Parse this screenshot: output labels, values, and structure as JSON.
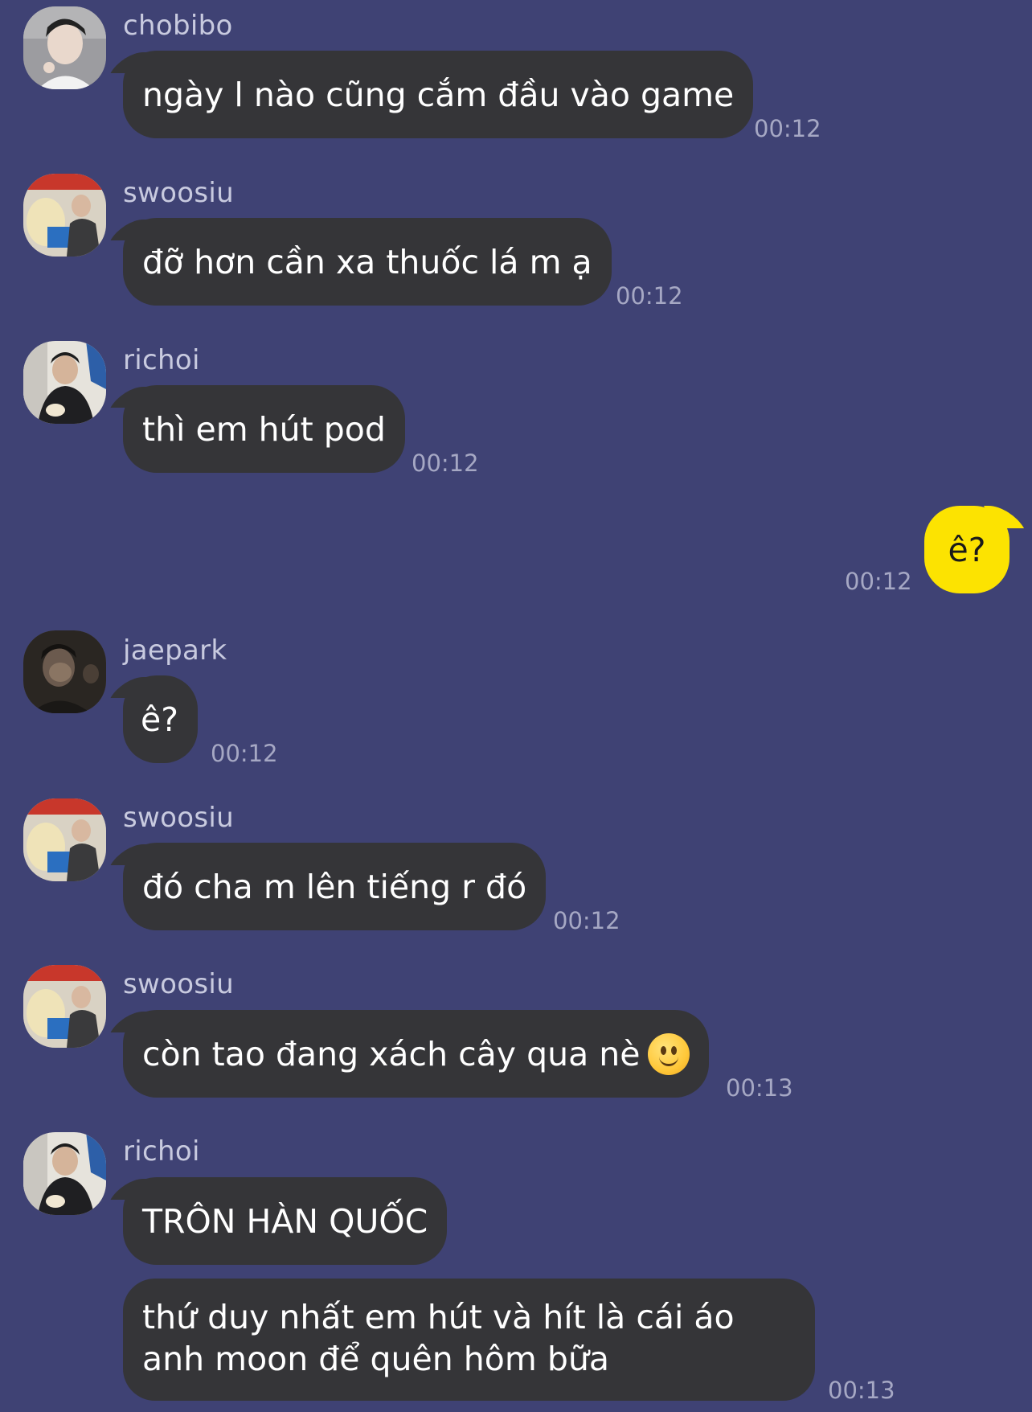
{
  "colors": {
    "background": "#3f4274",
    "bubble_other": "#353538",
    "bubble_mine": "#fce301",
    "sender_text": "#c8cadf",
    "timestamp_text": "#a6a8c4"
  },
  "messages": [
    {
      "sender": "chobibo",
      "avatar": "avatar-chobibo",
      "text": "ngày l nào cũng cắm đầu vào game",
      "time": "00:12"
    },
    {
      "sender": "swoosiu",
      "avatar": "avatar-swoosiu",
      "text": "đỡ hơn cần xa thuốc lá m ạ",
      "time": "00:12"
    },
    {
      "sender": "richoi",
      "avatar": "avatar-richoi",
      "text": "thì em hút pod",
      "time": "00:12"
    },
    {
      "sender": "",
      "mine": true,
      "text": "ê?",
      "time": "00:12"
    },
    {
      "sender": "jaepark",
      "avatar": "avatar-jaepark",
      "text": "ê?",
      "time": "00:12"
    },
    {
      "sender": "swoosiu",
      "avatar": "avatar-swoosiu",
      "text": "đó cha m lên tiếng r đó",
      "time": "00:12"
    },
    {
      "sender": "swoosiu",
      "avatar": "avatar-swoosiu",
      "text": "còn tao đang xách cây qua nè",
      "emoji": "slightly-smiling-face",
      "time": "00:13"
    },
    {
      "sender": "richoi",
      "avatar": "avatar-richoi",
      "text": "TRÔN HÀN QUỐC",
      "time": ""
    },
    {
      "sender": "",
      "avatar": "",
      "text": "thứ duy nhất em hút và hít là cái áo anh moon để quên hôm bữa",
      "time": "00:13"
    }
  ]
}
